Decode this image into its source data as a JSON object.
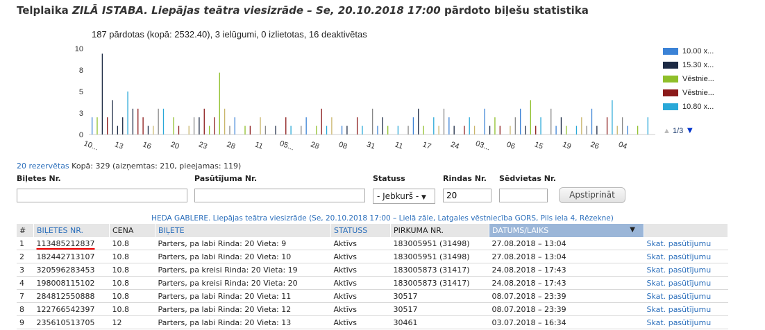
{
  "page": {
    "title_prefix": "Telplaika ",
    "title_italic": "ZILĀ ISTABA. Liepājas teātra viesizrāde – Se, 20.10.2018 17:00",
    "title_suffix": " pārdoto biļešu statistika"
  },
  "chart_data": {
    "type": "bar",
    "title": "187 pārdotas (kopā: 2532.40), 3 ielūgumi, 0 izlietotas, 16 deaktivētas",
    "y_ticks": [
      "0",
      "3",
      "5",
      "8",
      "10"
    ],
    "ylim": [
      0,
      10
    ],
    "x_tick_labels": [
      "10...",
      "13",
      "16",
      "20",
      "23",
      "28",
      "11",
      "05...",
      "28",
      "08",
      "31",
      "11",
      "17",
      "24",
      "03...",
      "06",
      "15",
      "19",
      "26",
      "04"
    ],
    "legend": [
      {
        "label": "10.00 x...",
        "color": "#3b82d6"
      },
      {
        "label": "15.30 x...",
        "color": "#1c2a44"
      },
      {
        "label": "Vēstnie...",
        "color": "#8fbf2a"
      },
      {
        "label": "Vēstnie...",
        "color": "#8b1a1a"
      },
      {
        "label": "10.80 x...",
        "color": "#29a8d8"
      }
    ],
    "legend_page": "1/3",
    "series": [
      {
        "name": "10.00 x...",
        "values": [
          0,
          0,
          0,
          0,
          0,
          0,
          0,
          0,
          0,
          0,
          0,
          0,
          0,
          0,
          0,
          0,
          0,
          0,
          0,
          0,
          0,
          0,
          0,
          0,
          0,
          0,
          0,
          0,
          0,
          0,
          0,
          0,
          0,
          0,
          0,
          0,
          0,
          0,
          0,
          0,
          0,
          0,
          0,
          0,
          0,
          0,
          0,
          0,
          0,
          0,
          0,
          0,
          0,
          0,
          0,
          0,
          0,
          0,
          0,
          0,
          0,
          0,
          0,
          0,
          0,
          0,
          0,
          0,
          0,
          0,
          0,
          0,
          0,
          0,
          0,
          0,
          0,
          0,
          0,
          0,
          0,
          0,
          0,
          0,
          0,
          0,
          0,
          0,
          0,
          0,
          0,
          0,
          0,
          0,
          0,
          0,
          0,
          0,
          0,
          0,
          0,
          0,
          0,
          0,
          0,
          0,
          0,
          0,
          0,
          0
        ]
      },
      {
        "name": "15.30 x...",
        "values": [
          0,
          0,
          9.4,
          0,
          4,
          1,
          2,
          0,
          0,
          0,
          0,
          1,
          0,
          0,
          1,
          0,
          0,
          0,
          0,
          0,
          0,
          2,
          0,
          0,
          0,
          0,
          0,
          0,
          0,
          0,
          0,
          0,
          0,
          0,
          0,
          0,
          0,
          0,
          0,
          0,
          0,
          0,
          0,
          0,
          0,
          0,
          0,
          0,
          0,
          0,
          0,
          0,
          0,
          0,
          0,
          0,
          0,
          0,
          0,
          0,
          0,
          0,
          0,
          0,
          0,
          0,
          0,
          0,
          0,
          0,
          0,
          0,
          0,
          0,
          0,
          0,
          0,
          0,
          0,
          0,
          0,
          0,
          0,
          0,
          0,
          0,
          0,
          0,
          0,
          0,
          0,
          0,
          0,
          0,
          0,
          0,
          0,
          0,
          0,
          0,
          0,
          0,
          0,
          0,
          0,
          0,
          0,
          0,
          0,
          0
        ]
      },
      {
        "name": "Vēstnie...",
        "values": [
          0,
          2,
          0,
          0,
          0,
          0,
          0,
          0,
          0,
          0,
          0,
          0,
          0,
          0,
          0,
          0,
          0,
          0,
          0,
          0,
          0,
          0,
          0,
          0,
          0,
          7.2,
          0,
          0,
          0,
          0,
          0,
          0,
          0,
          0,
          0,
          0,
          0,
          0,
          0,
          0,
          0,
          0,
          0,
          0,
          0,
          0,
          0,
          0,
          0,
          0,
          0,
          0,
          0,
          0,
          0,
          0,
          0,
          0,
          0,
          0,
          0,
          0,
          0,
          0,
          0,
          0,
          0,
          0,
          0,
          0,
          0,
          0,
          0,
          0,
          0,
          0,
          0,
          0,
          0,
          0,
          0,
          0,
          0,
          0,
          0,
          0,
          0,
          0,
          0,
          0,
          0,
          0,
          0,
          0,
          0,
          0,
          0,
          0,
          0,
          0,
          0,
          0,
          0,
          0,
          0,
          0,
          0,
          0,
          0
        ]
      },
      {
        "name": "Vēstnie...",
        "values": [
          0,
          0,
          0,
          0,
          0,
          0,
          0,
          0,
          0,
          3,
          0,
          0,
          0,
          0,
          0,
          0,
          0,
          0,
          0,
          0,
          0,
          0,
          3,
          0,
          0,
          0,
          0,
          0,
          0,
          0,
          0,
          0,
          0,
          0,
          0,
          0,
          0,
          0,
          0,
          0,
          0,
          0,
          0,
          0,
          0,
          0,
          0,
          0,
          0,
          0,
          0,
          0,
          0,
          0,
          0,
          0,
          0,
          0,
          0,
          0,
          0,
          0,
          0,
          0,
          0,
          0,
          0,
          0,
          0,
          0,
          0,
          0,
          0,
          0,
          0,
          0,
          0,
          0,
          0,
          0,
          0,
          0,
          0,
          0,
          0,
          0,
          0,
          0,
          0,
          0,
          0,
          0,
          0,
          0,
          0,
          0,
          0,
          0,
          0,
          0,
          0,
          0,
          0,
          0,
          0,
          0,
          0,
          0,
          0,
          0
        ]
      },
      {
        "name": "10.80 x...",
        "values": [
          0,
          0,
          0,
          0,
          0,
          0,
          0,
          5,
          0,
          0,
          0,
          0,
          0,
          0,
          3,
          0,
          0,
          0,
          0,
          0,
          0,
          0,
          0,
          0,
          0,
          0,
          0,
          0,
          0,
          0,
          0,
          0,
          0,
          0,
          0,
          0,
          0,
          0,
          0,
          0,
          0,
          0,
          0,
          0,
          0,
          0,
          0,
          0,
          0,
          0,
          0,
          0,
          0,
          0,
          0,
          0,
          0,
          0,
          0,
          0,
          0,
          0,
          0,
          0,
          0,
          0,
          0,
          0,
          0,
          0,
          0,
          0,
          0,
          0,
          0,
          0,
          0,
          0,
          0,
          0,
          0,
          0,
          0,
          0,
          0,
          0,
          0,
          0,
          0,
          0,
          0,
          0,
          0,
          0,
          0,
          0,
          0,
          0,
          0,
          0,
          0,
          0,
          0,
          0,
          0,
          0,
          0,
          0,
          0,
          0
        ]
      }
    ],
    "other_bars": [
      2,
      0,
      1,
      2,
      1,
      0,
      1,
      2,
      3,
      1,
      2,
      0,
      1,
      3,
      1,
      0,
      2,
      1,
      0,
      1,
      2,
      3,
      0,
      1,
      2,
      0,
      3,
      1,
      2,
      0,
      1,
      1,
      0,
      2,
      1,
      0,
      1,
      0,
      2,
      1,
      0,
      1,
      2,
      0,
      1,
      3,
      1,
      2,
      0,
      1,
      1,
      0,
      2,
      1,
      0,
      3,
      1,
      2,
      1,
      0,
      1,
      0,
      1,
      2,
      3,
      1,
      0,
      2,
      1,
      3,
      2,
      1,
      0,
      1,
      2,
      1,
      0,
      3,
      1,
      2,
      1,
      0,
      1,
      2,
      3,
      1,
      4,
      1,
      2,
      0,
      3,
      1,
      2,
      1,
      0,
      1,
      2,
      1,
      3,
      1,
      0,
      2,
      4,
      1,
      2,
      1,
      0,
      1,
      0,
      2
    ]
  },
  "reservations": {
    "link": "20 rezervētas",
    "text": " Kopā: 329 (aizņemtas: 210, pieejamas: 119)"
  },
  "filters": {
    "ticket_no_label": "Biļetes Nr.",
    "order_no_label": "Pasūtījuma Nr.",
    "status_label": "Statuss",
    "status_value": "- Jebkurš -",
    "row_label": "Rindas Nr.",
    "row_value": "20",
    "seat_label": "Sēdvietas Nr.",
    "confirm_label": "Apstiprināt"
  },
  "event_line": "HEDA GABLERE. Liepājas teātra viesizrāde (Se, 20.10.2018 17:00 – Lielā zāle, Latgales vēstniecība GORS, Pils iela 4, Rēzekne)",
  "table": {
    "headers": [
      "#",
      "BIĻETES NR.",
      "CENA",
      "BIĻETE",
      "STATUSS",
      "PIRKUMA NR.",
      "DATUMS/LAIKS",
      ""
    ],
    "rows": [
      [
        "1",
        "113485212837",
        "10.8",
        "Parters, pa labi Rinda: 20 Vieta: 9",
        "Aktīvs",
        "183005951 (31498)",
        "27.08.2018 – 13:04",
        "Skat. pasūtījumu"
      ],
      [
        "2",
        "182442713107",
        "10.8",
        "Parters, pa labi Rinda: 20 Vieta: 10",
        "Aktīvs",
        "183005951 (31498)",
        "27.08.2018 – 13:04",
        "Skat. pasūtījumu"
      ],
      [
        "3",
        "320596283453",
        "10.8",
        "Parters, pa kreisi Rinda: 20 Vieta: 19",
        "Aktīvs",
        "183005873 (31417)",
        "24.08.2018 – 17:43",
        "Skat. pasūtījumu"
      ],
      [
        "4",
        "198008115102",
        "10.8",
        "Parters, pa kreisi Rinda: 20 Vieta: 20",
        "Aktīvs",
        "183005873 (31417)",
        "24.08.2018 – 17:43",
        "Skat. pasūtījumu"
      ],
      [
        "7",
        "284812550888",
        "10.8",
        "Parters, pa labi Rinda: 20 Vieta: 11",
        "Aktīvs",
        "30517",
        "08.07.2018 – 23:39",
        "Skat. pasūtījumu"
      ],
      [
        "8",
        "122766542397",
        "10.8",
        "Parters, pa labi Rinda: 20 Vieta: 12",
        "Aktīvs",
        "30517",
        "08.07.2018 – 23:39",
        "Skat. pasūtījumu"
      ],
      [
        "9",
        "235610513705",
        "12",
        "Parters, pa labi Rinda: 20 Vieta: 13",
        "Aktīvs",
        "30461",
        "03.07.2018 – 16:34",
        "Skat. pasūtījumu"
      ]
    ]
  }
}
